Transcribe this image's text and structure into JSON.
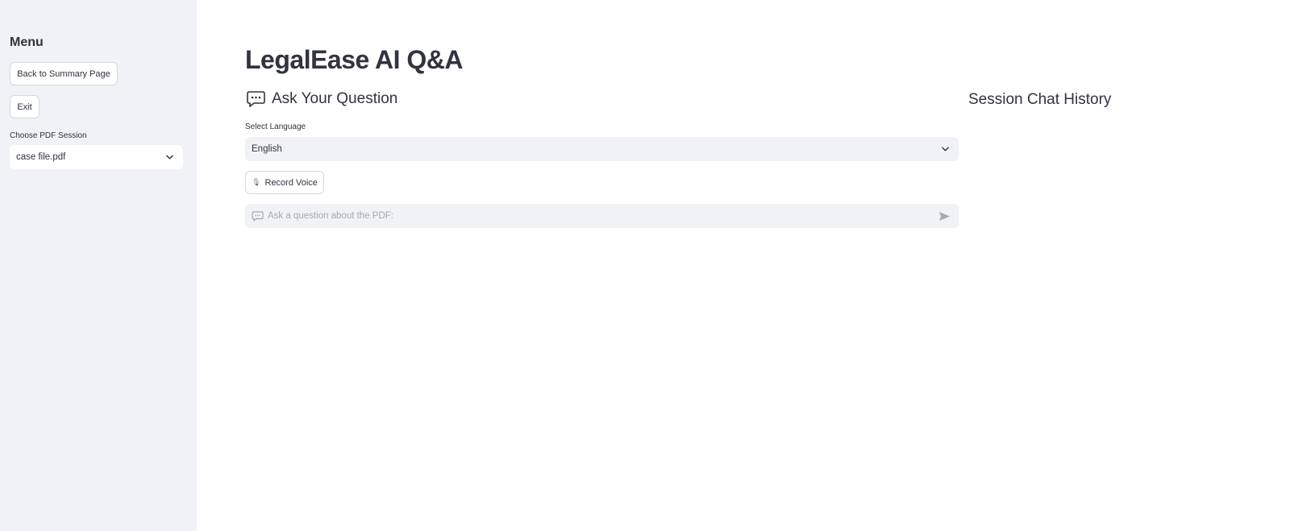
{
  "sidebar": {
    "title": "Menu",
    "back_button": "Back to Summary Page",
    "exit_button": "Exit",
    "session_label": "Choose PDF Session",
    "session_value": "case file.pdf"
  },
  "main": {
    "title": "LegalEase AI Q&A",
    "ask_heading": "Ask Your Question",
    "ask_heading_icon": "speech-bubble-dots-icon",
    "history_heading": "Session Chat History",
    "language_label": "Select Language",
    "language_value": "English",
    "record_button": "Record Voice",
    "record_icon": "microphone-icon",
    "chat_placeholder": "Ask a question about the PDF:"
  },
  "colors": {
    "sidebar_bg": "#f0f2f6",
    "text": "#31333f",
    "input_bg": "#f0f2f6",
    "placeholder": "#a3a8b4"
  }
}
